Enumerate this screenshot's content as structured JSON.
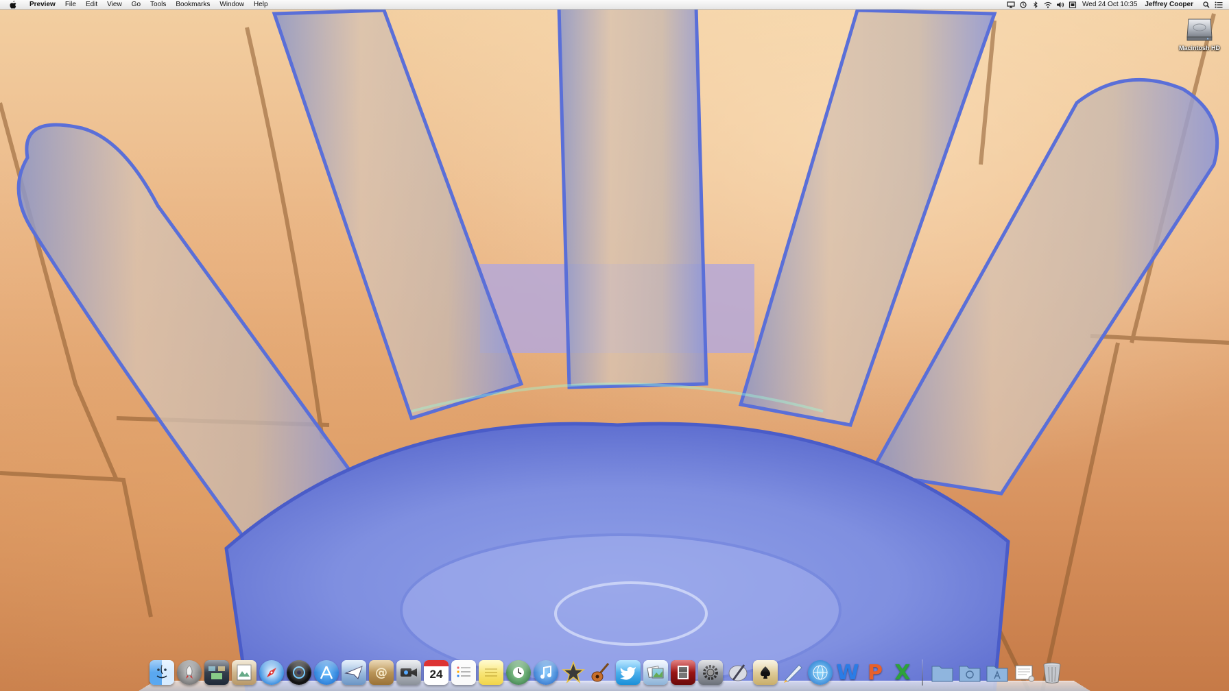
{
  "menubar": {
    "app_name": "Preview",
    "menus": [
      "File",
      "Edit",
      "View",
      "Go",
      "Tools",
      "Bookmarks",
      "Window",
      "Help"
    ],
    "status_icons": [
      "airplay-icon",
      "time-machine-icon",
      "bluetooth-icon",
      "wifi-icon",
      "volume-icon",
      "display-icon"
    ],
    "clock": "Wed 24 Oct  10:35",
    "user": "Jeffrey Cooper"
  },
  "desktop": {
    "hard_drive_label": "Macintosh HD"
  },
  "dock": {
    "calendar_day": "24",
    "apps": [
      {
        "name": "finder-icon"
      },
      {
        "name": "launchpad-icon"
      },
      {
        "name": "mission-control-icon"
      },
      {
        "name": "preview-icon"
      },
      {
        "name": "safari-icon"
      },
      {
        "name": "aperture-icon"
      },
      {
        "name": "app-store-icon"
      },
      {
        "name": "mail-icon"
      },
      {
        "name": "address-book-icon"
      },
      {
        "name": "facetime-icon"
      },
      {
        "name": "calendar-icon"
      },
      {
        "name": "reminders-icon"
      },
      {
        "name": "notes-icon"
      },
      {
        "name": "time-machine-icon"
      },
      {
        "name": "itunes-icon"
      },
      {
        "name": "imovie-icon"
      },
      {
        "name": "garageband-icon"
      },
      {
        "name": "twitter-icon"
      },
      {
        "name": "iphoto-icon"
      },
      {
        "name": "photo-booth-icon"
      },
      {
        "name": "system-preferences-icon"
      },
      {
        "name": "script-editor-icon"
      },
      {
        "name": "solitaire-icon"
      },
      {
        "name": "pages-icon"
      },
      {
        "name": "network-icon"
      },
      {
        "name": "word-icon"
      },
      {
        "name": "powerpoint-icon"
      },
      {
        "name": "excel-icon"
      }
    ],
    "folders": [
      "applications-folder-icon",
      "documents-folder-icon",
      "downloads-folder-icon",
      "preview-document-icon",
      "trash-icon"
    ],
    "word_letter": "W",
    "powerpoint_letter": "P",
    "excel_letter": "X"
  }
}
